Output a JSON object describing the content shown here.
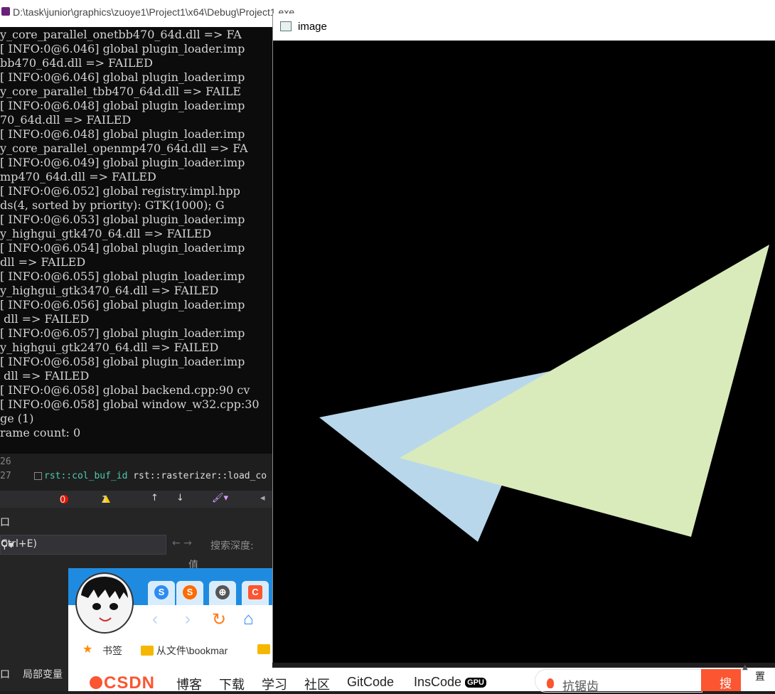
{
  "console": {
    "title": "D:\\task\\junior\\graphics\\zuoye1\\Project1\\x64\\Debug\\Project1.exe",
    "lines": [
      "y_core_parallel_onetbb470_64d.dll => FA",
      "[ INFO:0@6.046] global plugin_loader.imp",
      "bb470_64d.dll => FAILED",
      "[ INFO:0@6.046] global plugin_loader.imp",
      "y_core_parallel_tbb470_64d.dll => FAILE",
      "[ INFO:0@6.048] global plugin_loader.imp",
      "70_64d.dll => FAILED",
      "[ INFO:0@6.048] global plugin_loader.imp",
      "y_core_parallel_openmp470_64d.dll => FA",
      "[ INFO:0@6.049] global plugin_loader.imp",
      "mp470_64d.dll => FAILED",
      "[ INFO:0@6.052] global registry.impl.hpp",
      "ds(4, sorted by priority): GTK(1000); G",
      "[ INFO:0@6.053] global plugin_loader.imp",
      "y_highgui_gtk470_64.dll => FAILED",
      "[ INFO:0@6.054] global plugin_loader.imp",
      "dll => FAILED",
      "[ INFO:0@6.055] global plugin_loader.imp",
      "y_highgui_gtk3470_64.dll => FAILED",
      "[ INFO:0@6.056] global plugin_loader.imp",
      " dll => FAILED",
      "[ INFO:0@6.057] global plugin_loader.imp",
      "y_highgui_gtk2470_64.dll => FAILED",
      "[ INFO:0@6.058] global plugin_loader.imp",
      " dll => FAILED",
      "[ INFO:0@6.058] global backend.cpp:90 cv",
      "[ INFO:0@6.058] global window_w32.cpp:30",
      "ge (1)",
      "rame count: 0"
    ]
  },
  "editor": {
    "line_numbers": [
      "26",
      "27"
    ],
    "code_type": "rst::col_buf_id",
    "code_rest": " rst::rasterizer::load_co"
  },
  "toolbar": {
    "errors": "0",
    "warnings": "1",
    "up": "↑",
    "down": "↓"
  },
  "panel": {
    "title_fragment": "口",
    "search_placeholder": "Ctrl+E)",
    "search_depth_label": "搜索深度:",
    "value_header": "值",
    "tab_locals": "局部变量",
    "tab_prev": "口"
  },
  "browser": {
    "bookmarks_label": "书签",
    "bookmark_folder": "从文件\\bookmar"
  },
  "csdn": {
    "logo": "CSDN",
    "nav": [
      "博客",
      "下载",
      "学习",
      "社区",
      "GitCode",
      "InsCode"
    ],
    "gpu_badge": "GPU",
    "search_text": "抗锯齿",
    "search_button": "搜",
    "right_edge": "置"
  },
  "image_window": {
    "title": "image",
    "triangles": [
      {
        "name": "blue-triangle",
        "color": "#b9d7eb"
      },
      {
        "name": "green-triangle",
        "color": "#d9ebbb"
      }
    ]
  },
  "colors": {
    "console_bg": "#0c0c0c",
    "vs_bg": "#1e1e1e",
    "csdn_accent": "#fc5531",
    "browser_blue": "#1e8be0"
  }
}
